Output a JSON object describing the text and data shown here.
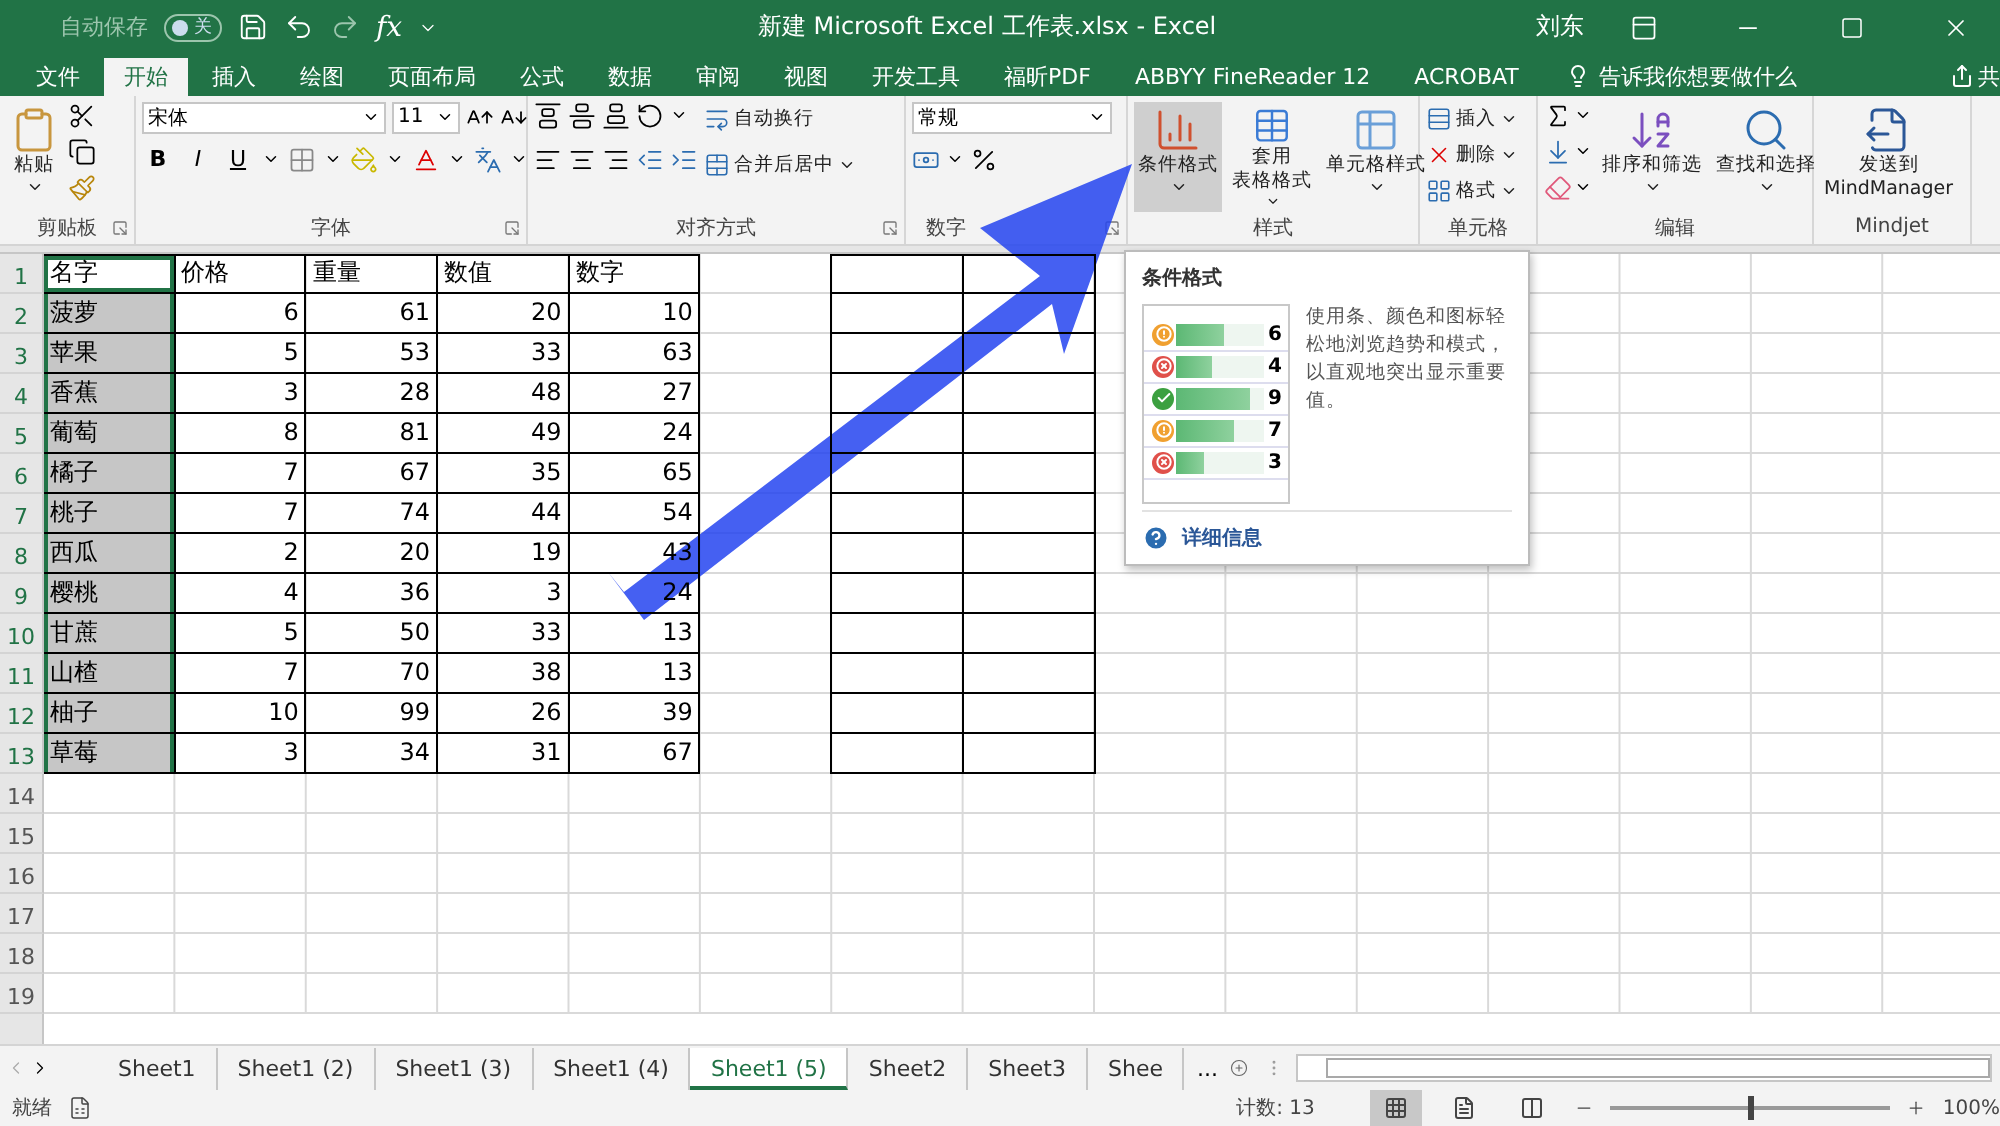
{
  "title_bar": {
    "autosave_label": "自动保存",
    "autosave_state": "关",
    "autosave_on": false,
    "fx": "fx",
    "title": "新建 Microsoft Excel 工作表.xlsx  -  Excel",
    "user": "刘东"
  },
  "tabs": [
    {
      "label": "文件",
      "selected": false
    },
    {
      "label": "开始",
      "selected": true
    },
    {
      "label": "插入",
      "selected": false
    },
    {
      "label": "绘图",
      "selected": false
    },
    {
      "label": "页面布局",
      "selected": false
    },
    {
      "label": "公式",
      "selected": false
    },
    {
      "label": "数据",
      "selected": false
    },
    {
      "label": "审阅",
      "selected": false
    },
    {
      "label": "视图",
      "selected": false
    },
    {
      "label": "开发工具",
      "selected": false
    },
    {
      "label": "福昕PDF",
      "selected": false
    },
    {
      "label": "ABBYY FineReader 12",
      "selected": false
    },
    {
      "label": "ACROBAT",
      "selected": false
    }
  ],
  "tell_me": "告诉我你想要做什么",
  "share": "共",
  "ribbon": {
    "groups": [
      {
        "kind": "clipboard",
        "label": "剪贴板",
        "paste": "粘贴"
      },
      {
        "kind": "font",
        "label": "字体",
        "font": "宋体",
        "size": "11",
        "bold": "B",
        "italic": "I",
        "underline": "U"
      },
      {
        "kind": "alignment",
        "label": "对齐方式",
        "wrap": "自动换行",
        "merge": "合并后居中"
      },
      {
        "kind": "number",
        "label": "数字",
        "format": "常规"
      },
      {
        "kind": "styles",
        "label": "样式",
        "buttons": [
          {
            "lines": [
              "条件格式"
            ],
            "selected": true
          },
          {
            "lines": [
              "套用",
              "表格格式"
            ],
            "selected": false
          },
          {
            "lines": [
              "单元格样式"
            ],
            "selected": false
          }
        ]
      },
      {
        "kind": "cells",
        "label": "单元格",
        "buttons": [
          "插入",
          "删除",
          "格式"
        ]
      },
      {
        "kind": "editing",
        "label": "编辑",
        "buttons": [
          "排序和筛选",
          "查找和选择"
        ]
      },
      {
        "kind": "addin",
        "label": "Mindjet",
        "lines": [
          "发送到",
          "MindManager"
        ]
      }
    ]
  },
  "sheet": {
    "rows": [
      {
        "number": "1",
        "selected": true,
        "active": true,
        "cells": [
          "名字",
          "价格",
          "重量",
          "数值",
          "数字"
        ]
      },
      {
        "number": "2",
        "selected": true,
        "active": false,
        "cells": [
          "菠萝",
          "6",
          "61",
          "20",
          "10"
        ]
      },
      {
        "number": "3",
        "selected": true,
        "active": false,
        "cells": [
          "苹果",
          "5",
          "53",
          "33",
          "63"
        ]
      },
      {
        "number": "4",
        "selected": true,
        "active": false,
        "cells": [
          "香蕉",
          "3",
          "28",
          "48",
          "27"
        ]
      },
      {
        "number": "5",
        "selected": true,
        "active": false,
        "cells": [
          "葡萄",
          "8",
          "81",
          "49",
          "24"
        ]
      },
      {
        "number": "6",
        "selected": true,
        "active": false,
        "cells": [
          "橘子",
          "7",
          "67",
          "35",
          "65"
        ]
      },
      {
        "number": "7",
        "selected": true,
        "active": false,
        "cells": [
          "桃子",
          "7",
          "74",
          "44",
          "54"
        ]
      },
      {
        "number": "8",
        "selected": true,
        "active": false,
        "cells": [
          "西瓜",
          "2",
          "20",
          "19",
          "43"
        ]
      },
      {
        "number": "9",
        "selected": true,
        "active": false,
        "cells": [
          "樱桃",
          "4",
          "36",
          "3",
          "24"
        ]
      },
      {
        "number": "10",
        "selected": true,
        "active": false,
        "cells": [
          "甘蔗",
          "5",
          "50",
          "33",
          "13"
        ]
      },
      {
        "number": "11",
        "selected": true,
        "active": false,
        "cells": [
          "山楂",
          "7",
          "70",
          "38",
          "13"
        ]
      },
      {
        "number": "12",
        "selected": true,
        "active": false,
        "cells": [
          "柚子",
          "10",
          "99",
          "26",
          "39"
        ]
      },
      {
        "number": "13",
        "selected": true,
        "active": false,
        "cells": [
          "草莓",
          "3",
          "34",
          "31",
          "67"
        ]
      },
      {
        "number": "14",
        "selected": false,
        "active": false
      },
      {
        "number": "15",
        "selected": false,
        "active": false
      },
      {
        "number": "16",
        "selected": false,
        "active": false
      },
      {
        "number": "17",
        "selected": false,
        "active": false
      },
      {
        "number": "18",
        "selected": false,
        "active": false
      },
      {
        "number": "19",
        "selected": false,
        "active": false
      }
    ]
  },
  "tooltip": {
    "title": "条件格式",
    "preview": [
      {
        "kind": "warning",
        "level": 0.55,
        "value": "6"
      },
      {
        "kind": "error",
        "level": 0.4,
        "value": "4"
      },
      {
        "kind": "ok",
        "level": 0.85,
        "value": "9"
      },
      {
        "kind": "warning",
        "level": 0.67,
        "value": "7"
      },
      {
        "kind": "error",
        "level": 0.32,
        "value": "3"
      }
    ],
    "description": "使用条、颜色和图标轻松地浏览趋势和模式，以直观地突出显示重要值。",
    "link": "详细信息"
  },
  "sheet_tabs": [
    {
      "label": "Sheet1",
      "selected": false
    },
    {
      "label": "Sheet1 (2)",
      "selected": false
    },
    {
      "label": "Sheet1 (3)",
      "selected": false
    },
    {
      "label": "Sheet1 (4)",
      "selected": false
    },
    {
      "label": "Sheet1 (5)",
      "selected": true
    },
    {
      "label": "Sheet2",
      "selected": false
    },
    {
      "label": "Sheet3",
      "selected": false
    },
    {
      "label": "Shee",
      "selected": false
    }
  ],
  "sheet_tabs_more": "...",
  "status_bar": {
    "ready": "就绪",
    "count": "计数: 13",
    "views": [
      {
        "selected": true
      },
      {
        "selected": false
      },
      {
        "selected": false
      }
    ],
    "zoom": {
      "level": 0.5,
      "reading": "100%"
    }
  }
}
